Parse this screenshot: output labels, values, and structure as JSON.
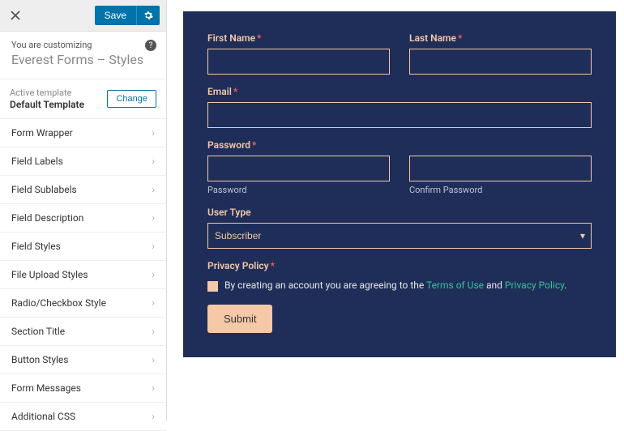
{
  "header": {
    "save": "Save"
  },
  "customizer": {
    "sub": "You are customizing",
    "title": "Everest Forms – Styles"
  },
  "template": {
    "label": "Active template",
    "name": "Default Template",
    "change": "Change"
  },
  "panels1": [
    "Form Wrapper",
    "Field Labels",
    "Field Sublabels",
    "Field Description",
    "Field Styles",
    "File Upload Styles",
    "Radio/Checkbox Style",
    "Section Title",
    "Button Styles"
  ],
  "panels2": [
    "Form Messages",
    "Additional CSS"
  ],
  "form": {
    "first_name": "First Name",
    "last_name": "Last Name",
    "email": "Email",
    "password": "Password",
    "pw_help": "Password",
    "cpw_help": "Confirm Password",
    "user_type": "User Type",
    "user_type_value": "Subscriber",
    "privacy": "Privacy Policy",
    "policy_pre": "By creating an account you are agreeing to the ",
    "tou": "Terms of Use",
    "and": " and ",
    "pp": "Privacy Policy",
    "dot": ".",
    "submit": "Submit"
  }
}
